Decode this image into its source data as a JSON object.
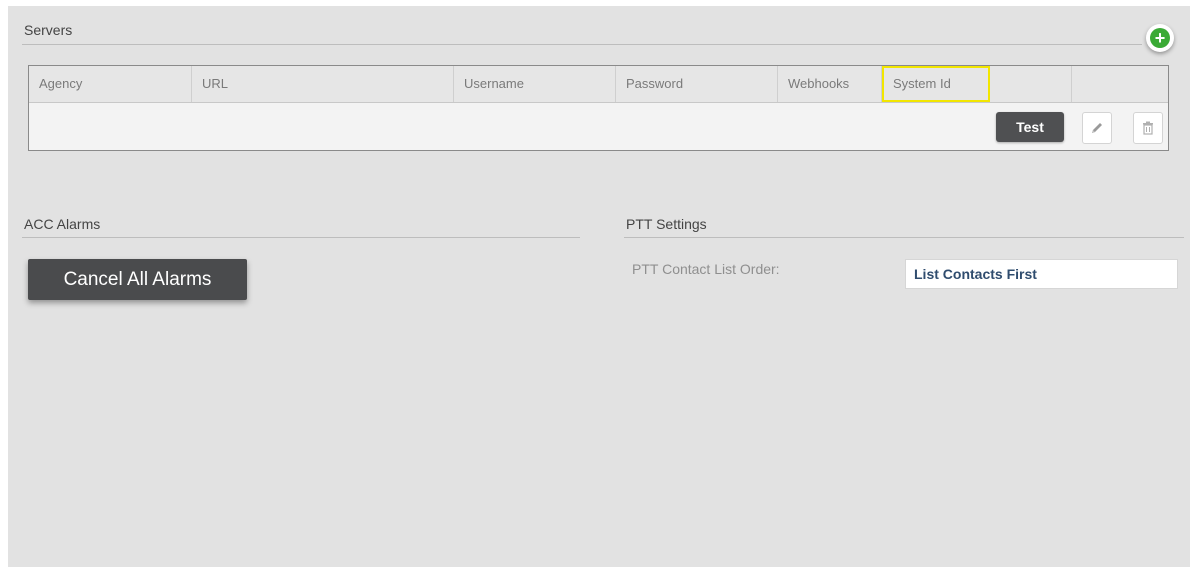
{
  "servers": {
    "title": "Servers",
    "add_icon": "plus-circle-icon",
    "columns": [
      "Agency",
      "URL",
      "Username",
      "Password",
      "Webhooks",
      "System Id"
    ],
    "test_label": "Test",
    "edit_icon": "pencil-icon",
    "delete_icon": "trash-icon"
  },
  "alarms": {
    "title": "ACC Alarms",
    "cancel_label": "Cancel All Alarms"
  },
  "ptt": {
    "title": "PTT Settings",
    "contact_order_label": "PTT Contact List Order:",
    "contact_order_value": "List Contacts First"
  },
  "colors": {
    "panel_bg": "#e2e2e2",
    "button_dark": "#4a4b4d",
    "add_green": "#3aaa35",
    "highlight_yellow": "#f2e600",
    "select_text": "#2f4c6e"
  }
}
